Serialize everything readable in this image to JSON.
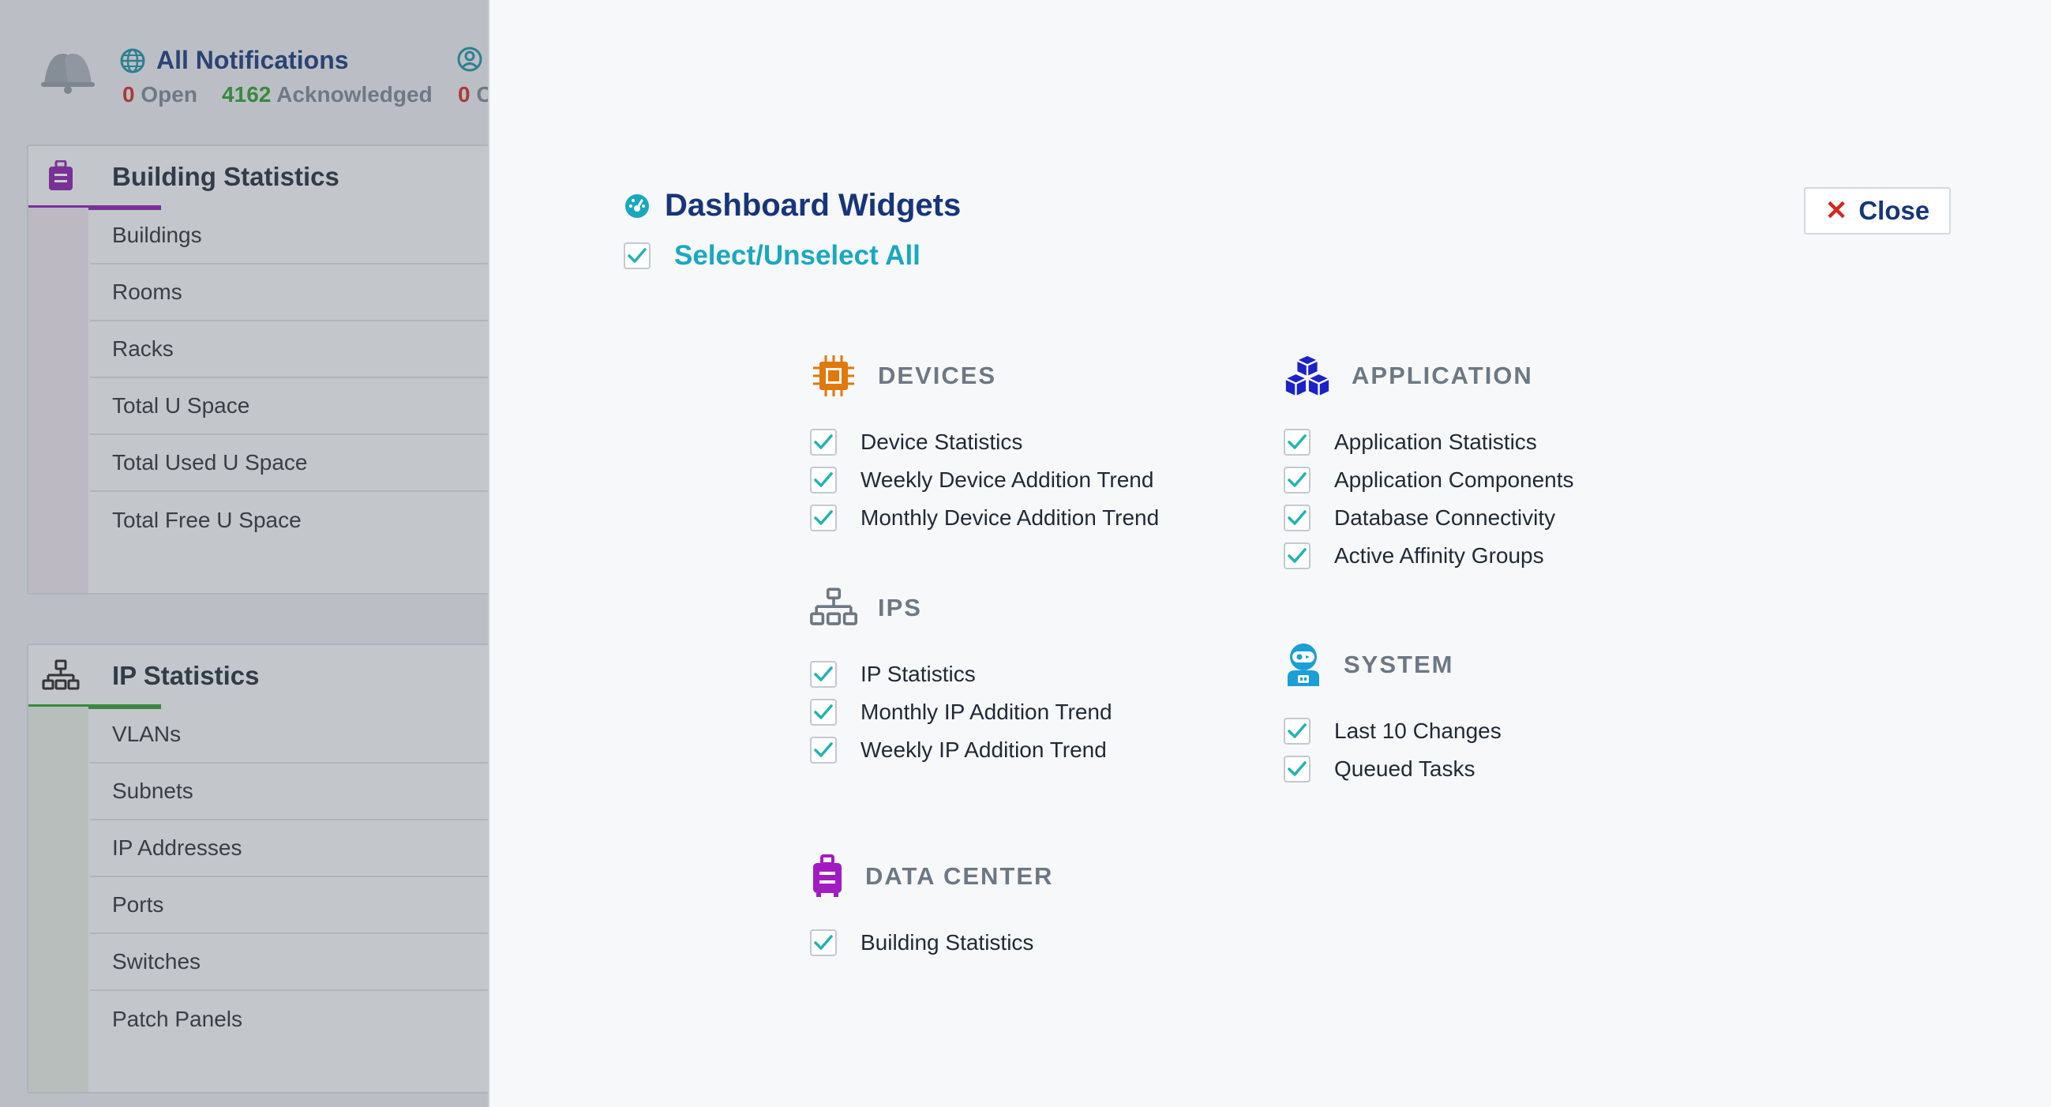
{
  "notifications": {
    "title": "All Notifications",
    "open_count": "0",
    "open_label": "Open",
    "ack_count": "4162",
    "ack_label": "Acknowledged",
    "second_count": "0",
    "second_label_partial": "C"
  },
  "background_cards": {
    "building": {
      "title": "Building Statistics",
      "items": [
        "Buildings",
        "Rooms",
        "Racks",
        "Total U Space",
        "Total Used U Space",
        "Total Free U Space"
      ]
    },
    "ip": {
      "title": "IP Statistics",
      "items": [
        "VLANs",
        "Subnets",
        "IP Addresses",
        "Ports",
        "Switches",
        "Patch Panels"
      ]
    }
  },
  "panel": {
    "title": "Dashboard Widgets",
    "select_all_label": "Select/Unselect All",
    "select_all_checked": true,
    "close_label": "Close"
  },
  "groups": {
    "devices": {
      "title": "DEVICES",
      "icon": "chip-icon",
      "items": [
        {
          "label": "Device Statistics",
          "checked": true
        },
        {
          "label": "Weekly Device Addition Trend",
          "checked": true
        },
        {
          "label": "Monthly Device Addition Trend",
          "checked": true
        }
      ]
    },
    "ips": {
      "title": "IPS",
      "icon": "network-icon",
      "items": [
        {
          "label": "IP Statistics",
          "checked": true
        },
        {
          "label": "Monthly IP Addition Trend",
          "checked": true
        },
        {
          "label": "Weekly IP Addition Trend",
          "checked": true
        }
      ]
    },
    "data_center": {
      "title": "DATA CENTER",
      "icon": "suitcase-icon",
      "items": [
        {
          "label": "Building Statistics",
          "checked": true
        }
      ]
    },
    "application": {
      "title": "APPLICATION",
      "icon": "cubes-icon",
      "items": [
        {
          "label": "Application Statistics",
          "checked": true
        },
        {
          "label": "Application Components",
          "checked": true
        },
        {
          "label": "Database Connectivity",
          "checked": true
        },
        {
          "label": "Active Affinity Groups",
          "checked": true
        }
      ]
    },
    "system": {
      "title": "SYSTEM",
      "icon": "robot-icon",
      "items": [
        {
          "label": "Last 10 Changes",
          "checked": true
        },
        {
          "label": "Queued Tasks",
          "checked": true
        }
      ]
    }
  },
  "colors": {
    "navy": "#16357a",
    "teal": "#1aa8c0",
    "check": "#22b3b3",
    "orange": "#e0780a",
    "blue": "#1b22c8",
    "purple": "#a21bc2",
    "cyan": "#1a9fd6",
    "slate": "#6c7884",
    "red": "#d4261e"
  }
}
